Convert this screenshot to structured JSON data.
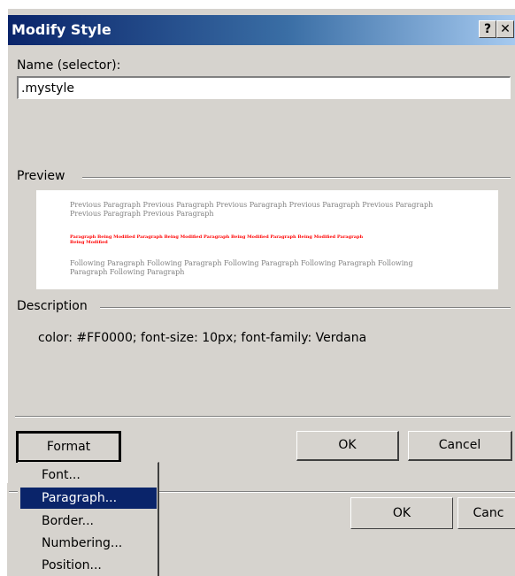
{
  "background_dialog": {
    "ok_label": "OK",
    "cancel_label": "Canc"
  },
  "dialog": {
    "title": "Modify Style",
    "help_label": "?",
    "close_label": "✕",
    "name_label": "Name (selector):",
    "name_value": ".mystyle",
    "preview_label": "Preview",
    "preview": {
      "previous": "Previous Paragraph Previous Paragraph Previous Paragraph Previous Paragraph Previous Paragraph Previous Paragraph Previous Paragraph",
      "current": "Paragraph Being Modified Paragraph Being Modified Paragraph Being Modified Paragraph Being Modified Paragraph Being Modified",
      "following": "Following Paragraph Following Paragraph Following Paragraph Following Paragraph Following Paragraph Following Paragraph"
    },
    "description_label": "Description",
    "description_text": "color: #FF0000; font-size: 10px; font-family: Verdana",
    "format_label": "Format",
    "ok_label": "OK",
    "cancel_label": "Cancel"
  },
  "format_menu": {
    "items": [
      "Font...",
      "Paragraph...",
      "Border...",
      "Numbering...",
      "Position..."
    ],
    "selected": "Paragraph..."
  },
  "colors": {
    "titlebar_start": "#0a246a",
    "face": "#d6d3ce",
    "selection": "#0a246a",
    "preview_current": "#ff0000"
  }
}
